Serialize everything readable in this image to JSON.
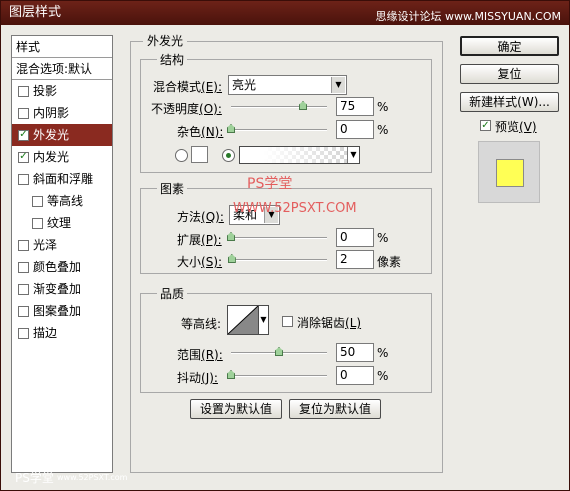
{
  "window": {
    "title": "图层样式"
  },
  "watermark": {
    "top": "思缘设计论坛",
    "top_url": "www.MISSYUAN.COM",
    "center1": "PS学堂",
    "center2": "WWW.52PSXT.COM",
    "bottom": "PS学堂",
    "bottom_url": "www.52PSXT.com"
  },
  "styles_list": {
    "header": "样式",
    "blend_options": "混合选项:默认",
    "items": [
      {
        "label": "投影",
        "checked": false
      },
      {
        "label": "内阴影",
        "checked": false
      },
      {
        "label": "外发光",
        "checked": true
      },
      {
        "label": "内发光",
        "checked": true
      },
      {
        "label": "斜面和浮雕",
        "checked": false
      },
      {
        "label": "等高线",
        "checked": false
      },
      {
        "label": "纹理",
        "checked": false
      },
      {
        "label": "光泽",
        "checked": false
      },
      {
        "label": "颜色叠加",
        "checked": false
      },
      {
        "label": "渐变叠加",
        "checked": false
      },
      {
        "label": "图案叠加",
        "checked": false
      },
      {
        "label": "描边",
        "checked": false
      }
    ],
    "check_mark": "✓"
  },
  "panel": {
    "title": "外发光",
    "structure": {
      "title": "结构",
      "blend_mode_label": "混合模式",
      "blend_mode_key": "(E):",
      "blend_mode_value": "亮光",
      "opacity_label": "不透明度",
      "opacity_key": "(O):",
      "opacity_value": "75",
      "noise_label": "杂色",
      "noise_key": "(N):",
      "noise_value": "0",
      "unit": "%"
    },
    "elements": {
      "title": "图素",
      "method_label": "方法",
      "method_key": "(Q):",
      "method_value": "柔和",
      "spread_label": "扩展",
      "spread_key": "(P):",
      "spread_value": "0",
      "size_label": "大小",
      "size_key": "(S):",
      "size_value": "2",
      "size_unit": "像素",
      "unit": "%"
    },
    "quality": {
      "title": "品质",
      "contour_label": "等高线:",
      "antialias_label": "消除锯齿",
      "antialias_key": "(L)",
      "range_label": "范围",
      "range_key": "(R):",
      "range_value": "50",
      "jitter_label": "抖动",
      "jitter_key": "(J):",
      "jitter_value": "0",
      "unit": "%"
    },
    "set_default": "设置为默认值",
    "reset_default": "复位为默认值"
  },
  "buttons": {
    "ok": "确定",
    "reset": "复位",
    "new_style": "新建样式(W)...",
    "preview_label": "预览",
    "preview_key": "(V)"
  },
  "colors": {
    "glow_preview": "#ffff55",
    "active_item": "#8a2a20"
  }
}
